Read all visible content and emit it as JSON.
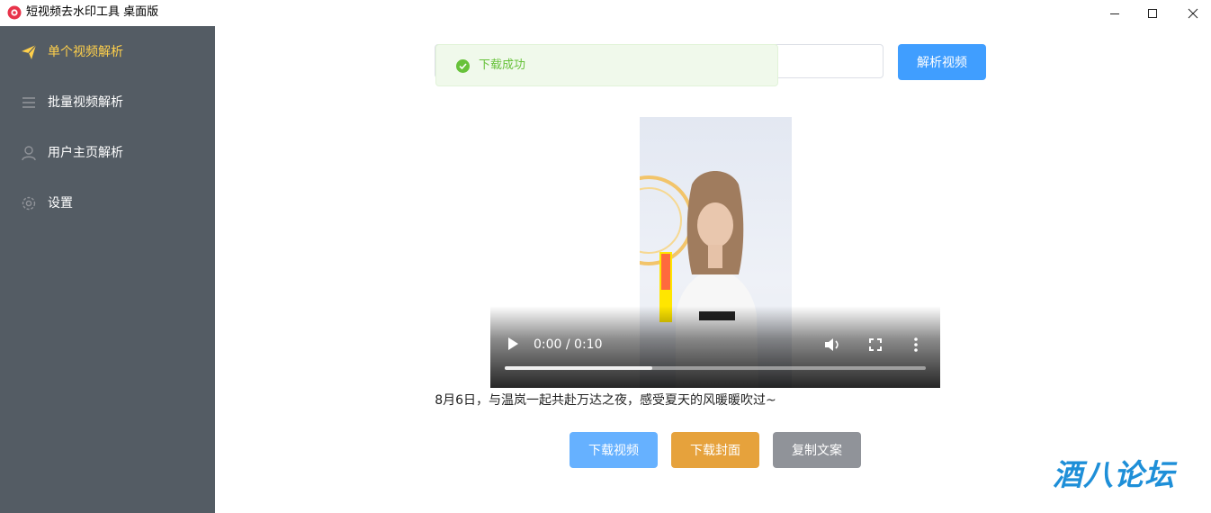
{
  "window": {
    "title": "短视频去水印工具 桌面版",
    "icons": {
      "app": "app-logo-icon",
      "minimize": "minimize-icon",
      "maximize": "maximize-icon",
      "close": "close-icon"
    }
  },
  "sidebar": {
    "background": "#545c64",
    "active_color": "#ffd04b",
    "items": [
      {
        "label": "单个视频解析",
        "icon": "send-icon",
        "active": true
      },
      {
        "label": "批量视频解析",
        "icon": "list-icon",
        "active": false
      },
      {
        "label": "用户主页解析",
        "icon": "user-icon",
        "active": false
      },
      {
        "label": "设置",
        "icon": "gear-icon",
        "active": false
      }
    ]
  },
  "search": {
    "value": "",
    "parse_button": "解析视频"
  },
  "toast": {
    "text": "下载成功",
    "icon": "check-circle-icon",
    "color": "#67c23a"
  },
  "video": {
    "time": "0:00 / 0:10",
    "progress_buffered": 0.35,
    "icons": [
      "play-icon",
      "volume-icon",
      "fullscreen-icon",
      "more-vertical-icon"
    ]
  },
  "caption": "8月6日，与温岚一起共赴万达之夜，感受夏天的风暖暖吹过~",
  "actions": {
    "download_video": "下载视频",
    "download_cover": "下载封面",
    "copy_text": "复制文案"
  },
  "watermark": "酒八论坛"
}
